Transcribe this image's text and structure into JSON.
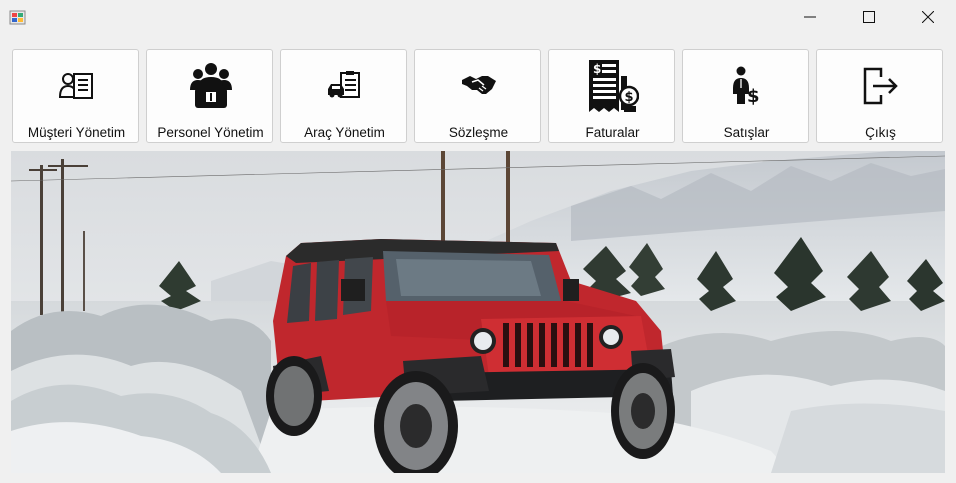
{
  "window": {
    "app_icon": "windows-forms-icon",
    "controls": {
      "minimize_icon": "minimize-icon",
      "maximize_icon": "maximize-icon",
      "close_icon": "close-icon"
    }
  },
  "menu": {
    "buttons": [
      {
        "label": "Müşteri Yönetim",
        "icon": "customer-card-icon"
      },
      {
        "label": "Personel Yönetim",
        "icon": "staff-group-icon"
      },
      {
        "label": "Araç Yönetim",
        "icon": "vehicle-checklist-icon"
      },
      {
        "label": "Sözleşme",
        "icon": "handshake-icon"
      },
      {
        "label": "Faturalar",
        "icon": "invoice-icon"
      },
      {
        "label": "Satışlar",
        "icon": "salesperson-icon"
      },
      {
        "label": "Çıkış",
        "icon": "exit-icon"
      }
    ]
  },
  "banner": {
    "subject": "red-jeep-snowy-landscape-photo"
  },
  "colors": {
    "jeep_red": "#c0272d",
    "snow": "#e8ecef",
    "window_bg": "#f0f0f0"
  }
}
